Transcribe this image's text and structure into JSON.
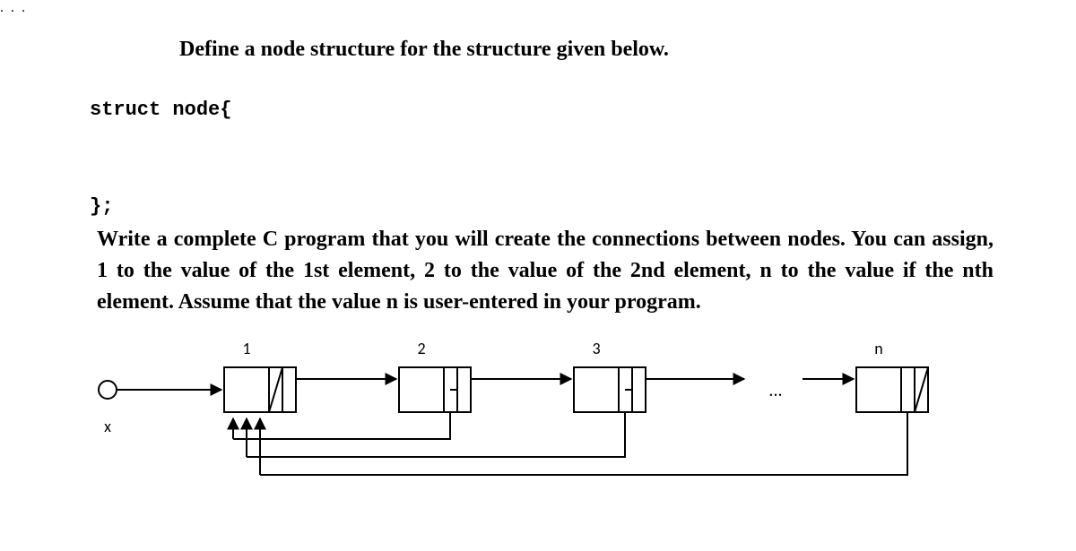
{
  "heading": "Define a node structure for the structure given below.",
  "code": {
    "open": "struct node{",
    "dots": ". . .",
    "close": "};"
  },
  "paragraph": "Write a complete C program that you will create the connections between nodes. You can assign, 1 to the value of the 1st element, 2 to the value of the 2nd element, n to the value if the nth element. Assume that the value n is user-entered in your program.",
  "diagram": {
    "nodes": [
      {
        "label": "1"
      },
      {
        "label": "2"
      },
      {
        "label": "3"
      },
      {
        "label": "n"
      }
    ],
    "head_label": "x",
    "ellipsis": "..."
  }
}
